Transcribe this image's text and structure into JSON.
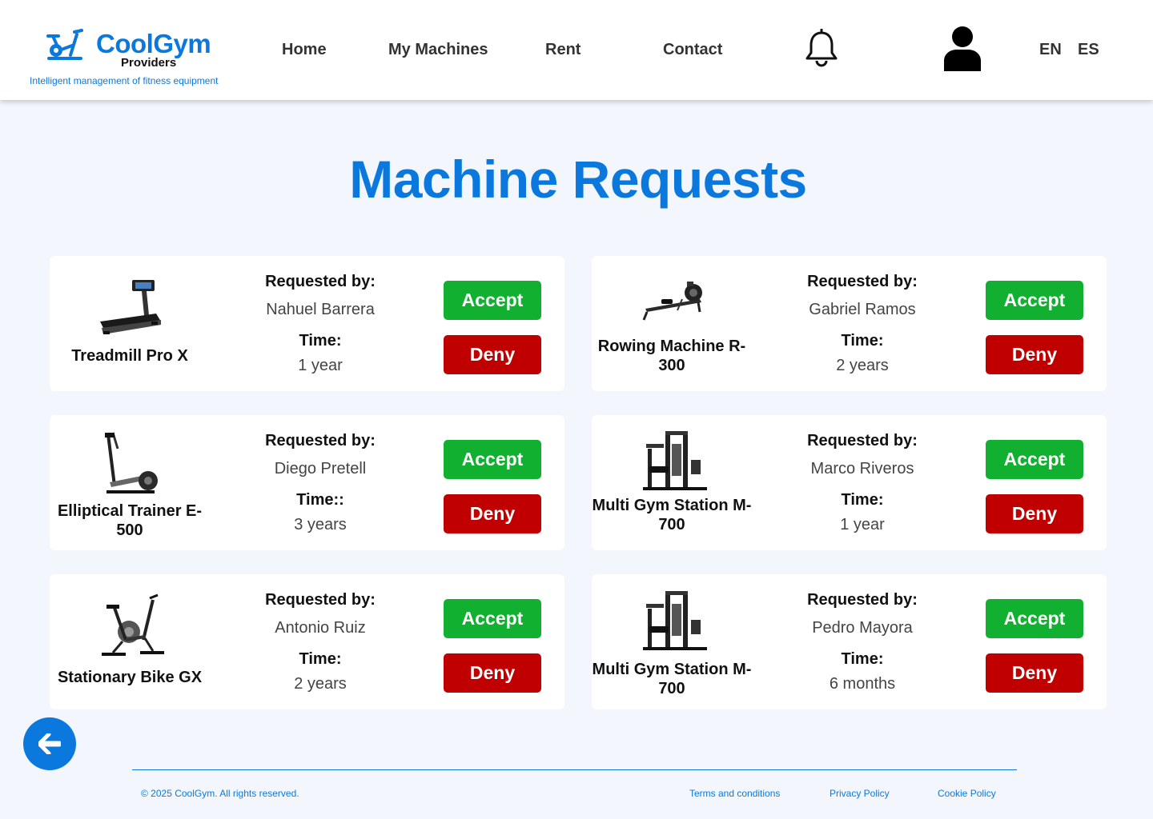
{
  "header": {
    "brand": "CoolGym",
    "brand_sub": "Providers",
    "tagline": "Intelligent management of fitness equipment",
    "nav": [
      "Home",
      "My Machines",
      "Rent",
      "Contact"
    ],
    "languages": [
      "EN",
      "ES"
    ]
  },
  "page_title": "Machine Requests",
  "requests": [
    {
      "machine_name": "Treadmill Pro X",
      "requested_by_label": "Requested by:",
      "requester": "Nahuel Barrera",
      "time_label": "Time:",
      "time": "1 year",
      "accept_label": "Accept",
      "deny_label": "Deny",
      "image": "treadmill"
    },
    {
      "machine_name": "Rowing Machine R-300",
      "requested_by_label": "Requested by:",
      "requester": "Gabriel Ramos",
      "time_label": "Time:",
      "time": "2 years",
      "accept_label": "Accept",
      "deny_label": "Deny",
      "image": "rowing-machine"
    },
    {
      "machine_name": "Elliptical Trainer E-500",
      "requested_by_label": "Requested by:",
      "requester": "Diego Pretell",
      "time_label": "Time::",
      "time": "3 years",
      "accept_label": "Accept",
      "deny_label": "Deny",
      "image": "elliptical-trainer"
    },
    {
      "machine_name": "Multi Gym Station M-700",
      "requested_by_label": "Requested by:",
      "requester": "Marco Riveros",
      "time_label": "Time:",
      "time": "1 year",
      "accept_label": "Accept",
      "deny_label": "Deny",
      "image": "multi-gym-station"
    },
    {
      "machine_name": "Stationary Bike GX",
      "requested_by_label": "Requested by:",
      "requester": "Antonio Ruiz",
      "time_label": "Time:",
      "time": "2 years",
      "accept_label": "Accept",
      "deny_label": "Deny",
      "image": "stationary-bike"
    },
    {
      "machine_name": "Multi Gym Station M-700",
      "requested_by_label": "Requested by:",
      "requester": "Pedro Mayora",
      "time_label": "Time:",
      "time": "6 months",
      "accept_label": "Accept",
      "deny_label": "Deny",
      "image": "multi-gym-station"
    }
  ],
  "footer": {
    "copyright": "© 2025 CoolGym. All rights reserved.",
    "links": [
      "Terms and conditions",
      "Privacy Policy",
      "Cookie Policy"
    ]
  },
  "icons": [
    "bike-logo-icon",
    "bell-icon",
    "user-icon",
    "arrow-left-icon"
  ],
  "colors": {
    "brand_blue": "#0a78dc",
    "accept_green": "#12b030",
    "deny_red": "#c00000",
    "page_background": "#f3f7fd"
  }
}
